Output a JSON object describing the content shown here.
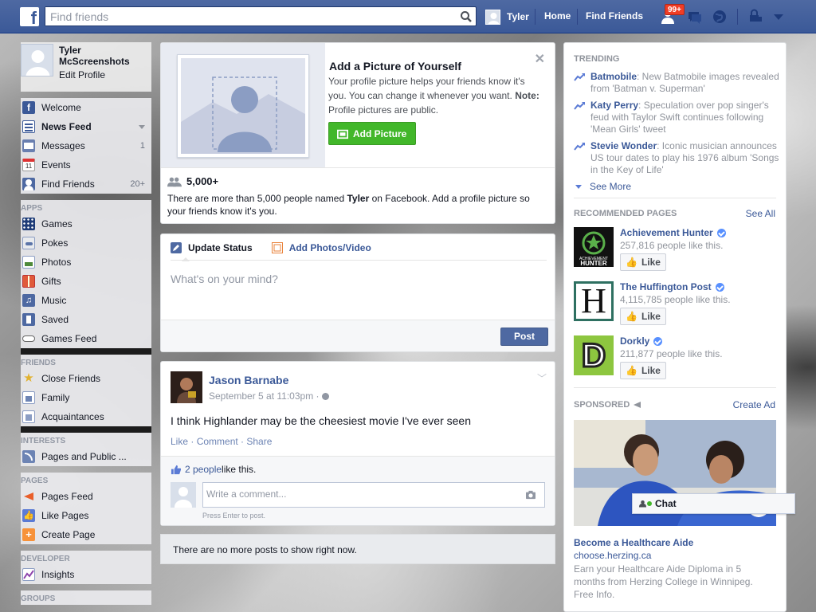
{
  "topbar": {
    "search_placeholder": "Find friends",
    "user_name": "Tyler",
    "home": "Home",
    "find_friends": "Find Friends",
    "notif_badge": "99+"
  },
  "leftnav": {
    "profile": {
      "name": "Tyler McScreenshots",
      "edit": "Edit Profile"
    },
    "main": [
      {
        "label": "Welcome",
        "icon": "facebook-icon",
        "count": ""
      },
      {
        "label": "News Feed",
        "icon": "news-feed-icon",
        "count": ""
      },
      {
        "label": "Messages",
        "icon": "messages-icon",
        "count": "1"
      },
      {
        "label": "Events",
        "icon": "calendar-icon",
        "count": ""
      },
      {
        "label": "Find Friends",
        "icon": "find-friends-icon",
        "count": "20+"
      }
    ],
    "apps_header": "APPS",
    "apps": [
      "Games",
      "Pokes",
      "Photos",
      "Gifts",
      "Music",
      "Saved",
      "Games Feed"
    ],
    "friends_header": "FRIENDS",
    "friends": [
      "Close Friends",
      "Family",
      "Acquaintances"
    ],
    "interests_header": "INTERESTS",
    "interests": [
      "Pages and Public ..."
    ],
    "pages_header": "PAGES",
    "pages": [
      "Pages Feed",
      "Like Pages",
      "Create Page"
    ],
    "developer_header": "DEVELOPER",
    "developer": [
      "Insights"
    ],
    "groups_header": "GROUPS"
  },
  "addpic": {
    "title": "Add a Picture of Yourself",
    "desc": "Your profile picture helps your friends know it's you. You can change it whenever you want.",
    "note_label": "Note:",
    "note": "Profile pictures are public.",
    "button": "Add Picture",
    "count": "5,000+",
    "count_desc_pre": "There are more than 5,000 people named ",
    "count_desc_name": "Tyler",
    "count_desc_post": " on Facebook. Add a profile picture so your friends know it's you."
  },
  "composer": {
    "tab_status": "Update Status",
    "tab_photos": "Add Photos/Video",
    "placeholder": "What's on your mind?",
    "post": "Post"
  },
  "post": {
    "author": "Jason Barnabe",
    "time": "September 5 at 11:03pm · ",
    "text": "I think Highlander may be the cheesiest movie I've ever seen",
    "like": "Like",
    "comment": "Comment",
    "share": "Share",
    "likes_count": "2 people",
    "likes_suffix": " like this.",
    "comment_placeholder": "Write a comment...",
    "hint": "Press Enter to post."
  },
  "nomore": "There are no more posts to show right now.",
  "trending": {
    "header": "TRENDING",
    "items": [
      {
        "topic": "Batmobile",
        "text": ": New Batmobile images revealed from 'Batman v. Superman'"
      },
      {
        "topic": "Katy Perry",
        "text": ": Speculation over pop singer's feud with Taylor Swift continues following 'Mean Girls' tweet"
      },
      {
        "topic": "Stevie Wonder",
        "text": ": Iconic musician announces US tour dates to play his 1976 album 'Songs in the Key of Life'"
      }
    ],
    "see_more": "See More"
  },
  "recommended": {
    "header": "RECOMMENDED PAGES",
    "see_all": "See All",
    "pages": [
      {
        "name": "Achievement Hunter",
        "likes": "257,816 people like this.",
        "like": "Like"
      },
      {
        "name": "The Huffington Post",
        "likes": "4,115,785 people like this.",
        "like": "Like"
      },
      {
        "name": "Dorkly",
        "likes": "211,877 people like this.",
        "like": "Like"
      }
    ],
    "logo_texts": {
      "ah_top": "ACHIEVEMENT",
      "ah_bottom": "HUNTER",
      "huff": "H",
      "dorkly": "D"
    }
  },
  "sponsored": {
    "header": "SPONSORED",
    "create_ad": "Create Ad",
    "ad_title": "Become a Healthcare Aide",
    "ad_url": "choose.herzing.ca",
    "ad_text": "Earn your Healthcare Aide Diploma in 5 months from Herzing College in Winnipeg. Free Info."
  },
  "chat": {
    "label": "Chat"
  },
  "colors": {
    "brand": "#3b5998",
    "green": "#42b72a",
    "badge": "#f03d25"
  }
}
